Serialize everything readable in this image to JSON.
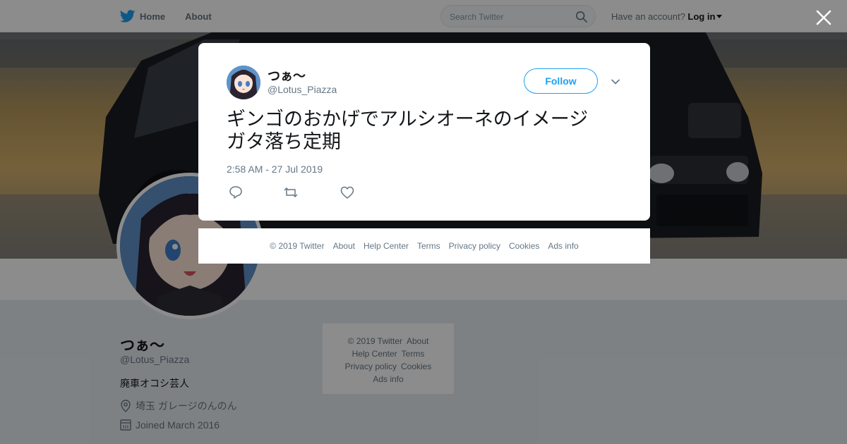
{
  "nav": {
    "home_label": "Home",
    "about_label": "About",
    "search_placeholder": "Search Twitter",
    "account_prompt": "Have an account?",
    "login_label": "Log in"
  },
  "profile": {
    "name": "つぁ〜",
    "handle": "@Lotus_Piazza",
    "bio": "廃車オコシ芸人",
    "location": "埼玉 ガレージのんのん",
    "joined": "Joined March 2016"
  },
  "sidebar_footer": {
    "copyright": "© 2019 Twitter",
    "about": "About",
    "help": "Help Center",
    "terms": "Terms",
    "privacy": "Privacy policy",
    "cookies": "Cookies",
    "ads": "Ads info"
  },
  "tweet": {
    "name": "つぁ〜",
    "handle": "@Lotus_Piazza",
    "follow_label": "Follow",
    "text_line1": "ギンゴのおかげでアルシオーネのイメージ",
    "text_line2": "ガタ落ち定期",
    "timestamp": "2:58 AM - 27 Jul 2019"
  },
  "modal_footer": {
    "copyright": "© 2019 Twitter",
    "about": "About",
    "help": "Help Center",
    "terms": "Terms",
    "privacy": "Privacy policy",
    "cookies": "Cookies",
    "ads": "Ads info"
  },
  "colors": {
    "twitter_blue": "#1da1f2",
    "text_primary": "#14171a",
    "text_secondary": "#657786",
    "background": "#e6ecf0"
  },
  "icons": [
    "twitter-bird-icon",
    "search-icon",
    "close-icon",
    "chevron-down-icon",
    "reply-icon",
    "retweet-icon",
    "like-icon",
    "location-icon",
    "calendar-icon"
  ]
}
